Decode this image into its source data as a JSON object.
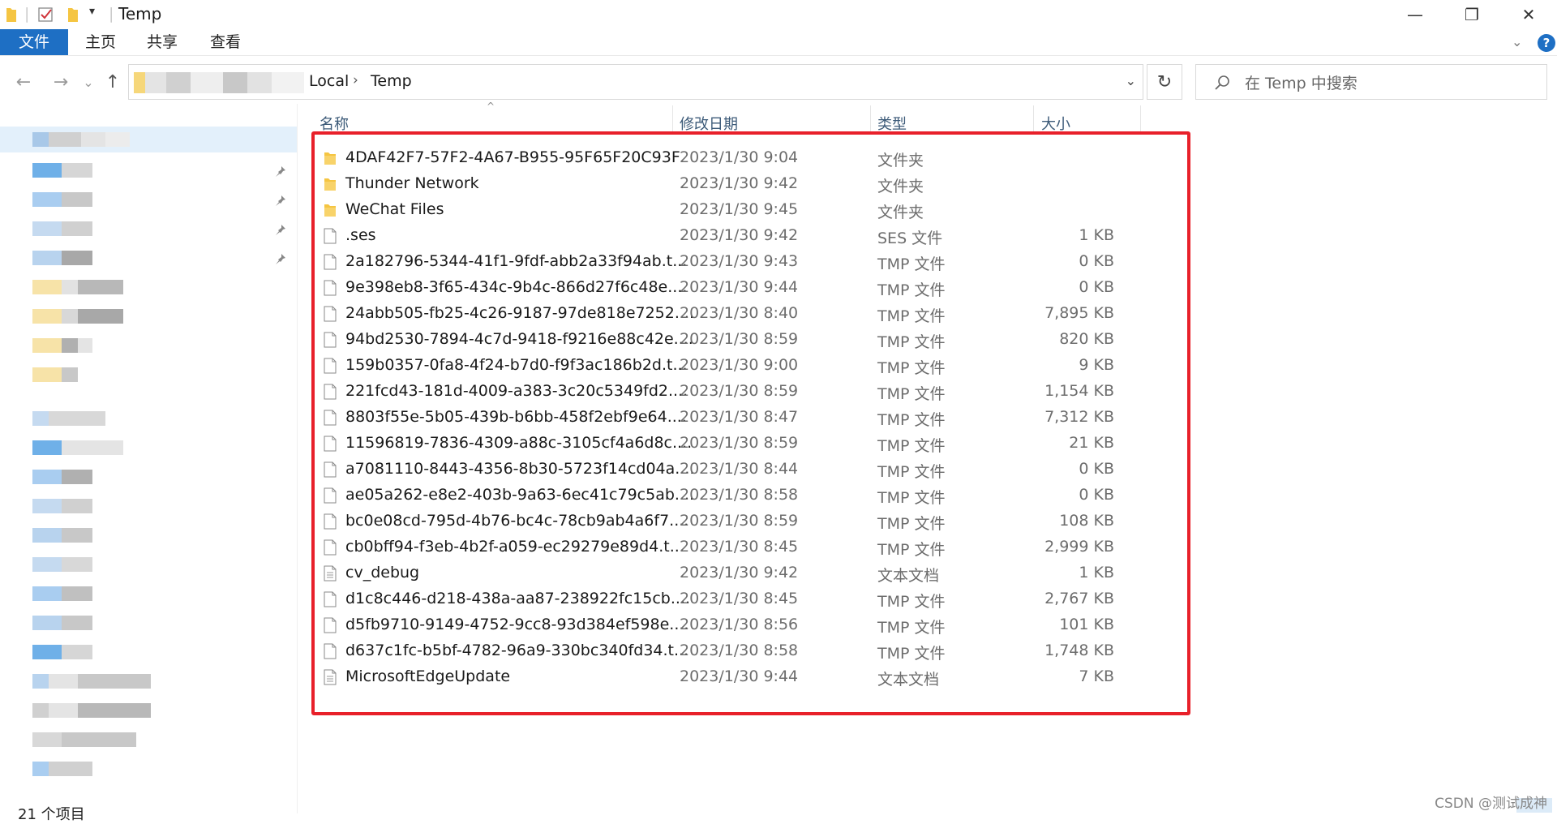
{
  "window": {
    "title": "Temp",
    "minimize": "—",
    "restore": "❐",
    "close": "✕"
  },
  "ribbon": {
    "tabs": [
      "文件",
      "主页",
      "共享",
      "查看"
    ],
    "help": "?"
  },
  "nav": {
    "back": "←",
    "forward": "→",
    "recent": "⌄",
    "up": "↑",
    "breadcrumb": [
      "Local",
      "Temp"
    ],
    "refresh": "↻",
    "search_placeholder": "在 Temp 中搜索"
  },
  "columns": {
    "name": "名称",
    "date": "修改日期",
    "type": "类型",
    "size": "大小"
  },
  "files": [
    {
      "name": "4DAF42F7-57F2-4A67-B955-95F65F20C93F",
      "date": "2023/1/30 9:04",
      "type": "文件夹",
      "size": "",
      "icon": "folder-icon"
    },
    {
      "name": "Thunder Network",
      "date": "2023/1/30 9:42",
      "type": "文件夹",
      "size": "",
      "icon": "folder-icon"
    },
    {
      "name": "WeChat Files",
      "date": "2023/1/30 9:45",
      "type": "文件夹",
      "size": "",
      "icon": "folder-icon"
    },
    {
      "name": ".ses",
      "date": "2023/1/30 9:42",
      "type": "SES 文件",
      "size": "1 KB",
      "icon": "file-icon"
    },
    {
      "name": "2a182796-5344-41f1-9fdf-abb2a33f94ab.t...",
      "date": "2023/1/30 9:43",
      "type": "TMP 文件",
      "size": "0 KB",
      "icon": "file-icon"
    },
    {
      "name": "9e398eb8-3f65-434c-9b4c-866d27f6c48e....",
      "date": "2023/1/30 9:44",
      "type": "TMP 文件",
      "size": "0 KB",
      "icon": "file-icon"
    },
    {
      "name": "24abb505-fb25-4c26-9187-97de818e7252....",
      "date": "2023/1/30 8:40",
      "type": "TMP 文件",
      "size": "7,895 KB",
      "icon": "file-icon"
    },
    {
      "name": "94bd2530-7894-4c7d-9418-f9216e88c42e....",
      "date": "2023/1/30 8:59",
      "type": "TMP 文件",
      "size": "820 KB",
      "icon": "file-icon"
    },
    {
      "name": "159b0357-0fa8-4f24-b7d0-f9f3ac186b2d.t...",
      "date": "2023/1/30 9:00",
      "type": "TMP 文件",
      "size": "9 KB",
      "icon": "file-icon"
    },
    {
      "name": "221fcd43-181d-4009-a383-3c20c5349fd2....",
      "date": "2023/1/30 8:59",
      "type": "TMP 文件",
      "size": "1,154 KB",
      "icon": "file-icon"
    },
    {
      "name": "8803f55e-5b05-439b-b6bb-458f2ebf9e64....",
      "date": "2023/1/30 8:47",
      "type": "TMP 文件",
      "size": "7,312 KB",
      "icon": "file-icon"
    },
    {
      "name": "11596819-7836-4309-a88c-3105cf4a6d8c....",
      "date": "2023/1/30 8:59",
      "type": "TMP 文件",
      "size": "21 KB",
      "icon": "file-icon"
    },
    {
      "name": "a7081110-8443-4356-8b30-5723f14cd04a....",
      "date": "2023/1/30 8:44",
      "type": "TMP 文件",
      "size": "0 KB",
      "icon": "file-icon"
    },
    {
      "name": "ae05a262-e8e2-403b-9a63-6ec41c79c5ab....",
      "date": "2023/1/30 8:58",
      "type": "TMP 文件",
      "size": "0 KB",
      "icon": "file-icon"
    },
    {
      "name": "bc0e08cd-795d-4b76-bc4c-78cb9ab4a6f7....",
      "date": "2023/1/30 8:59",
      "type": "TMP 文件",
      "size": "108 KB",
      "icon": "file-icon"
    },
    {
      "name": "cb0bff94-f3eb-4b2f-a059-ec29279e89d4.t...",
      "date": "2023/1/30 8:45",
      "type": "TMP 文件",
      "size": "2,999 KB",
      "icon": "file-icon"
    },
    {
      "name": "cv_debug",
      "date": "2023/1/30 9:42",
      "type": "文本文档",
      "size": "1 KB",
      "icon": "text-file-icon"
    },
    {
      "name": "d1c8c446-d218-438a-aa87-238922fc15cb....",
      "date": "2023/1/30 8:45",
      "type": "TMP 文件",
      "size": "2,767 KB",
      "icon": "file-icon"
    },
    {
      "name": "d5fb9710-9149-4752-9cc8-93d384ef598e....",
      "date": "2023/1/30 8:56",
      "type": "TMP 文件",
      "size": "101 KB",
      "icon": "file-icon"
    },
    {
      "name": "d637c1fc-b5bf-4782-96a9-330bc340fd34.t...",
      "date": "2023/1/30 8:58",
      "type": "TMP 文件",
      "size": "1,748 KB",
      "icon": "file-icon"
    },
    {
      "name": "MicrosoftEdgeUpdate",
      "date": "2023/1/30 9:44",
      "type": "文本文档",
      "size": "7 KB",
      "icon": "text-file-icon"
    }
  ],
  "status": {
    "item_count": "21 个项目"
  },
  "watermark": "CSDN @测试成神",
  "colors": {
    "accent": "#1e6fc4",
    "highlight_border": "#e8202a",
    "folder": "#f5c542"
  }
}
